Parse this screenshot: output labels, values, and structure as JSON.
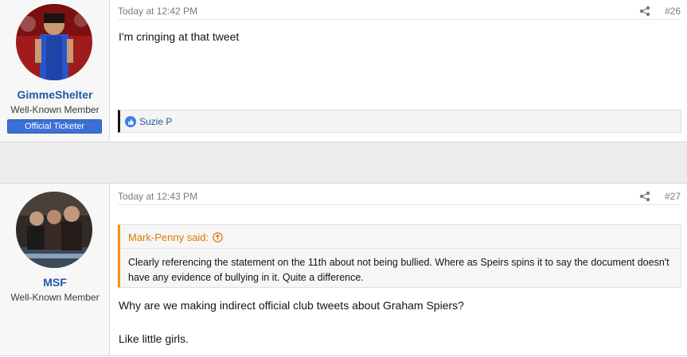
{
  "posts": [
    {
      "username": "GimmeShelter",
      "user_title": "Well-Known Member",
      "banner": "Official Ticketer",
      "date": "Today at 12:42 PM",
      "post_number": "#26",
      "message": "I'm cringing at that tweet",
      "reactions": {
        "icon": "like-icon",
        "users": "Suzie P"
      }
    },
    {
      "username": "MSF",
      "user_title": "Well-Known Member",
      "date": "Today at 12:43 PM",
      "post_number": "#27",
      "quote": {
        "author": "Mark-Penny said:",
        "text": "Clearly referencing the statement on the 11th about not being bullied. Where as Speirs spins it to say the document doesn't have any evidence of bullying in it. Quite a difference."
      },
      "message_lines": [
        "Why are we making indirect official club tweets about Graham Spiers?",
        "Like little girls."
      ]
    }
  ],
  "colors": {
    "username": "#2258a6",
    "banner_bg": "#3d70d6",
    "quote_accent": "#f2930d",
    "quote_author": "#db7c05"
  }
}
